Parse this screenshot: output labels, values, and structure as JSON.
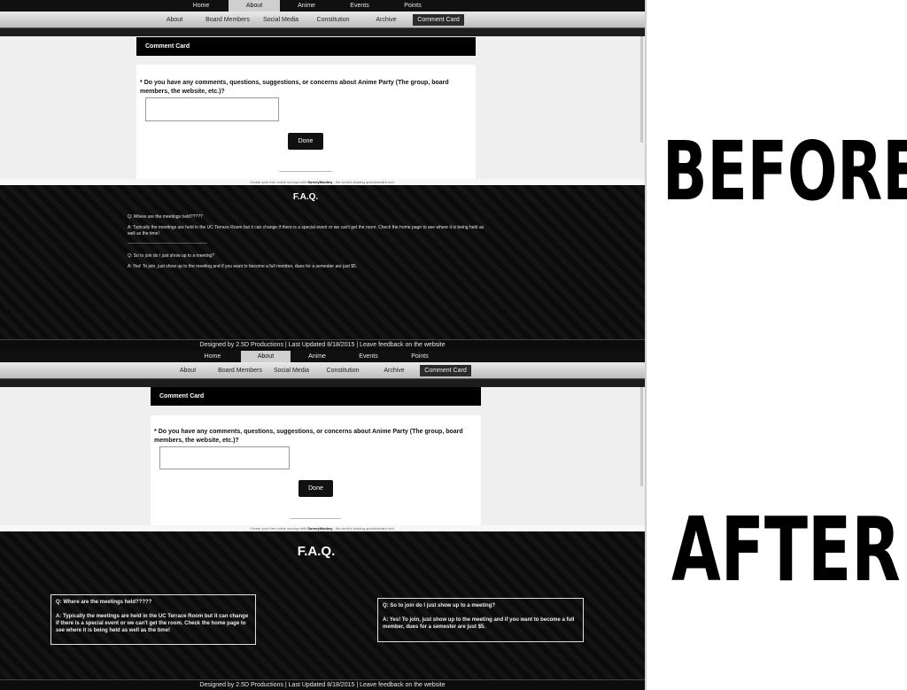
{
  "nav": {
    "top": [
      "Home",
      "About",
      "Anime",
      "Events",
      "Points"
    ],
    "top_active": "About",
    "sub": [
      "About",
      "Board Members",
      "Social Media",
      "Constitution",
      "Archive",
      "Comment Card"
    ],
    "sub_active": "Comment Card"
  },
  "survey": {
    "header": "Comment Card",
    "required_mark": "*",
    "question": "Do you have any comments, questions, suggestions, or concerns about Anime Party (The group, board members, the website, etc.)?",
    "done_label": "Done",
    "powered_prefix": "Create your free online surveys with",
    "powered_brand": "SurveyMonkey",
    "powered_suffix": ", the world's leading questionnaire tool."
  },
  "faq": {
    "title": "F.A.Q.",
    "q1": "Q: Where are the meetings held?????",
    "a1": "A: Typically the meetings are held in the UC Terrace Room but it can change if there is a special event or we can't get the room. Check the home page to see where it is being held as well as the time!",
    "separator": "------------------------------------------------------",
    "q2": "Q: So to join do I just show up to a meeting?",
    "a2": "A: Yes! To join, just show up to the meeting and if you want to become a full member, dues for a semester are just $5."
  },
  "footer": "Designed by 2.5D Productions | Last Updated 8/18/2015 | Leave feedback on the website",
  "labels": {
    "before": "BEFORE",
    "after": "AFTER"
  }
}
